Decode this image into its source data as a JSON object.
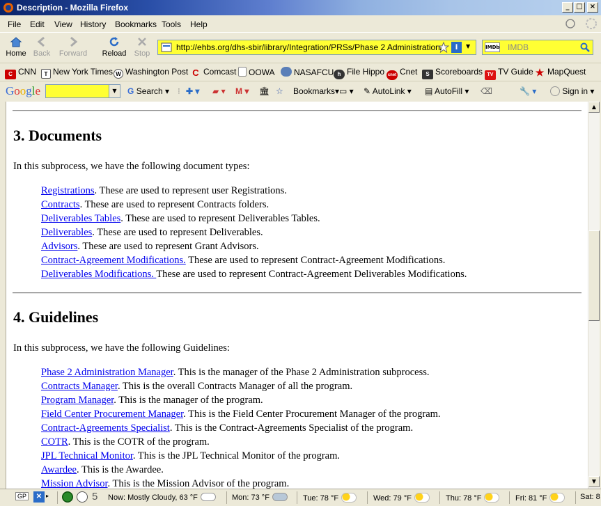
{
  "window": {
    "title": "Description - Mozilla Firefox"
  },
  "menu": [
    "File",
    "Edit",
    "View",
    "History",
    "Bookmarks",
    "Tools",
    "Help"
  ],
  "nav": {
    "home": "Home",
    "back": "Back",
    "forward": "Forward",
    "reload": "Reload",
    "stop": "Stop",
    "url": "http://ehbs.org/dhs-sbir/library/Integration/PRSs/Phase 2 Administration/Des",
    "search_placeholder": "IMDB"
  },
  "bookmarks": [
    {
      "label": "CNN",
      "icon": "cnn-icon"
    },
    {
      "label": "New York Times",
      "icon": "nyt-icon"
    },
    {
      "label": "Washington Post",
      "icon": "wapo-icon"
    },
    {
      "label": "Comcast",
      "icon": "comcast-icon"
    },
    {
      "label": "OOWA",
      "icon": "page-icon"
    },
    {
      "label": "NASAFCU",
      "icon": "nasafcu-icon"
    },
    {
      "label": "File Hippo",
      "icon": "filehippo-icon"
    },
    {
      "label": "Cnet",
      "icon": "cnet-icon"
    },
    {
      "label": "Scoreboards",
      "icon": "scoreboards-icon"
    },
    {
      "label": "TV Guide",
      "icon": "tvguide-icon"
    },
    {
      "label": "MapQuest",
      "icon": "mapquest-icon"
    }
  ],
  "google_toolbar": {
    "logo": "Google",
    "search": "Search",
    "bookmarks": "Bookmarks",
    "autolink": "AutoLink",
    "autofill": "AutoFill",
    "signin": "Sign in"
  },
  "content": {
    "section3": {
      "heading": "3. Documents",
      "intro": "In this subprocess, we have the following document types:",
      "items": [
        {
          "link": "Registrations",
          "text": ". These are used to represent user Registrations."
        },
        {
          "link": "Contracts",
          "text": ". These are used to represent Contracts folders."
        },
        {
          "link": "Deliverables Tables",
          "text": ". These are used to represent Deliverables Tables."
        },
        {
          "link": "Deliverables",
          "text": ". These are used to represent Deliverables."
        },
        {
          "link": "Advisors",
          "text": ". These are used to represent Grant Advisors."
        },
        {
          "link": "Contract-Agreement Modifications.",
          "text": " These are used to represent Contract-Agreement Modifications."
        },
        {
          "link": "Deliverables Modifications. ",
          "text": "These are used to represent Contract-Agreement Deliverables Modifications."
        }
      ]
    },
    "section4": {
      "heading": "4. Guidelines",
      "intro": "In this subprocess, we have the following Guidelines:",
      "items": [
        {
          "link": "Phase 2 Administration Manager",
          "text": ". This is the manager of the Phase 2 Administration subprocess."
        },
        {
          "link": "Contracts Manager",
          "text": ". This is the overall Contracts Manager of all the program."
        },
        {
          "link": "Program Manager",
          "text": ". This is the manager of the program."
        },
        {
          "link": "Field Center Procurement Manager",
          "text": ". This is the Field Center Procurement Manager of the program."
        },
        {
          "link": "Contract-Agreements Specialist",
          "text": ". This is the Contract-Agreements Specialist of the program."
        },
        {
          "link": "COTR",
          "text": ". This is the COTR of the program."
        },
        {
          "link": "JPL Technical Monitor",
          "text": ". This is the JPL Technical Monitor of the program."
        },
        {
          "link": "Awardee",
          "text": ". This is the Awardee."
        },
        {
          "link": "Mission Advisor",
          "text": ". This is the Mission Advisor of the program."
        }
      ]
    }
  },
  "status": {
    "gp": "GP",
    "count": "5",
    "now": "Now: Mostly Cloudy, 63 °F",
    "mon": "Mon: 73 °F",
    "tue": "Tue: 78 °F",
    "wed": "Wed: 79 °F",
    "thu": "Thu: 78 °F",
    "fri": "Fri: 81 °F",
    "sat": "Sat: 8"
  }
}
